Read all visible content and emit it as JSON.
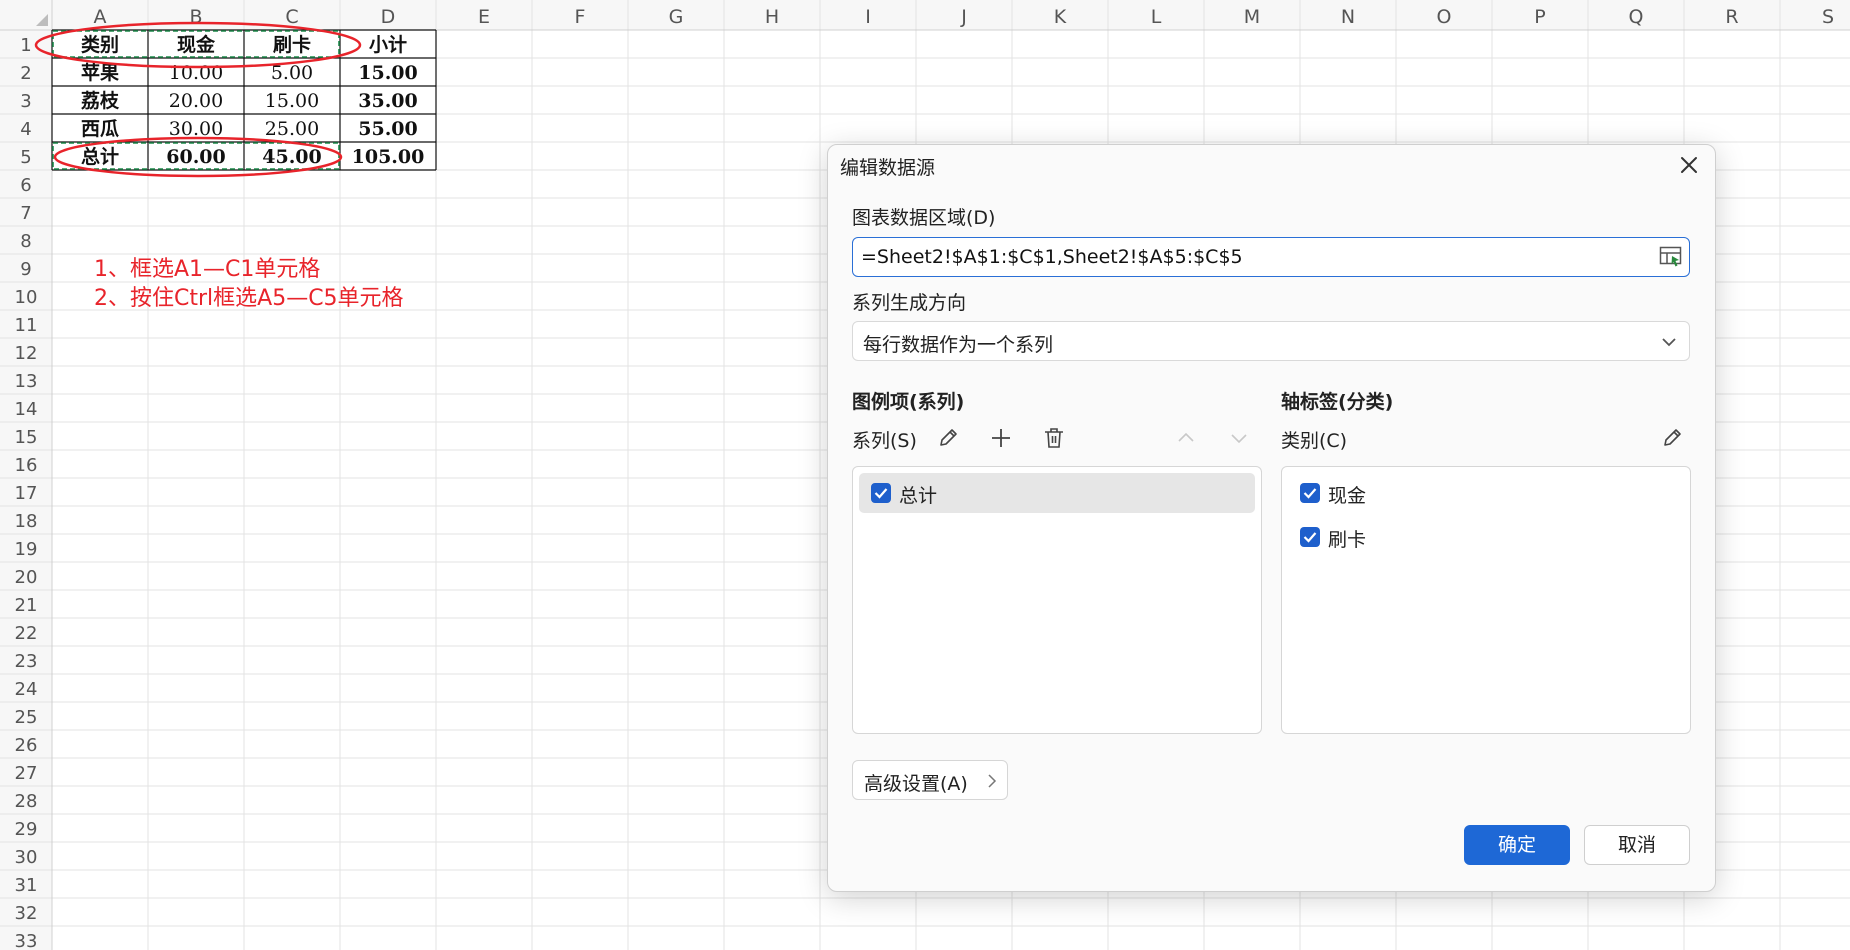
{
  "spreadsheet": {
    "columns": [
      "A",
      "B",
      "C",
      "D",
      "E",
      "F",
      "G",
      "H",
      "I",
      "J",
      "K",
      "L",
      "M",
      "N",
      "O",
      "P",
      "Q",
      "R",
      "S"
    ],
    "rows": [
      "1",
      "2",
      "3",
      "4",
      "5",
      "6",
      "7",
      "8",
      "9",
      "10",
      "11",
      "12",
      "13",
      "14",
      "15",
      "16",
      "17",
      "18",
      "19",
      "20",
      "21",
      "22",
      "23",
      "24",
      "25",
      "26",
      "27",
      "28",
      "29",
      "30",
      "31",
      "32",
      "33"
    ],
    "cells": [
      [
        "类别",
        "现金",
        "刷卡",
        "小计"
      ],
      [
        "苹果",
        "10.00",
        "5.00",
        "15.00"
      ],
      [
        "荔枝",
        "20.00",
        "15.00",
        "35.00"
      ],
      [
        "西瓜",
        "30.00",
        "25.00",
        "55.00"
      ],
      [
        "总计",
        "60.00",
        "45.00",
        "105.00"
      ]
    ]
  },
  "annotations": [
    "1、框选A1—C1单元格",
    "2、按住Ctrl框选A5—C5单元格"
  ],
  "colors": {
    "annotation_red": "#e8242b",
    "accent_blue": "#1e68d6",
    "selection_green": "#1f8a4c"
  },
  "dialog": {
    "title": "编辑数据源",
    "range_label": "图表数据区域(D)",
    "range_value": "=Sheet2!$A$1:$C$1,Sheet2!$A$5:$C$5",
    "direction_label": "系列生成方向",
    "direction_value": "每行数据作为一个系列",
    "legend_heading": "图例项(系列)",
    "series_label": "系列(S)",
    "axis_heading": "轴标签(分类)",
    "category_label": "类别(C)",
    "series_items": [
      {
        "label": "总计",
        "checked": true
      }
    ],
    "category_items": [
      {
        "label": "现金",
        "checked": true
      },
      {
        "label": "刷卡",
        "checked": true
      }
    ],
    "advanced_label": "高级设置(A)",
    "ok_label": "确定",
    "cancel_label": "取消"
  }
}
